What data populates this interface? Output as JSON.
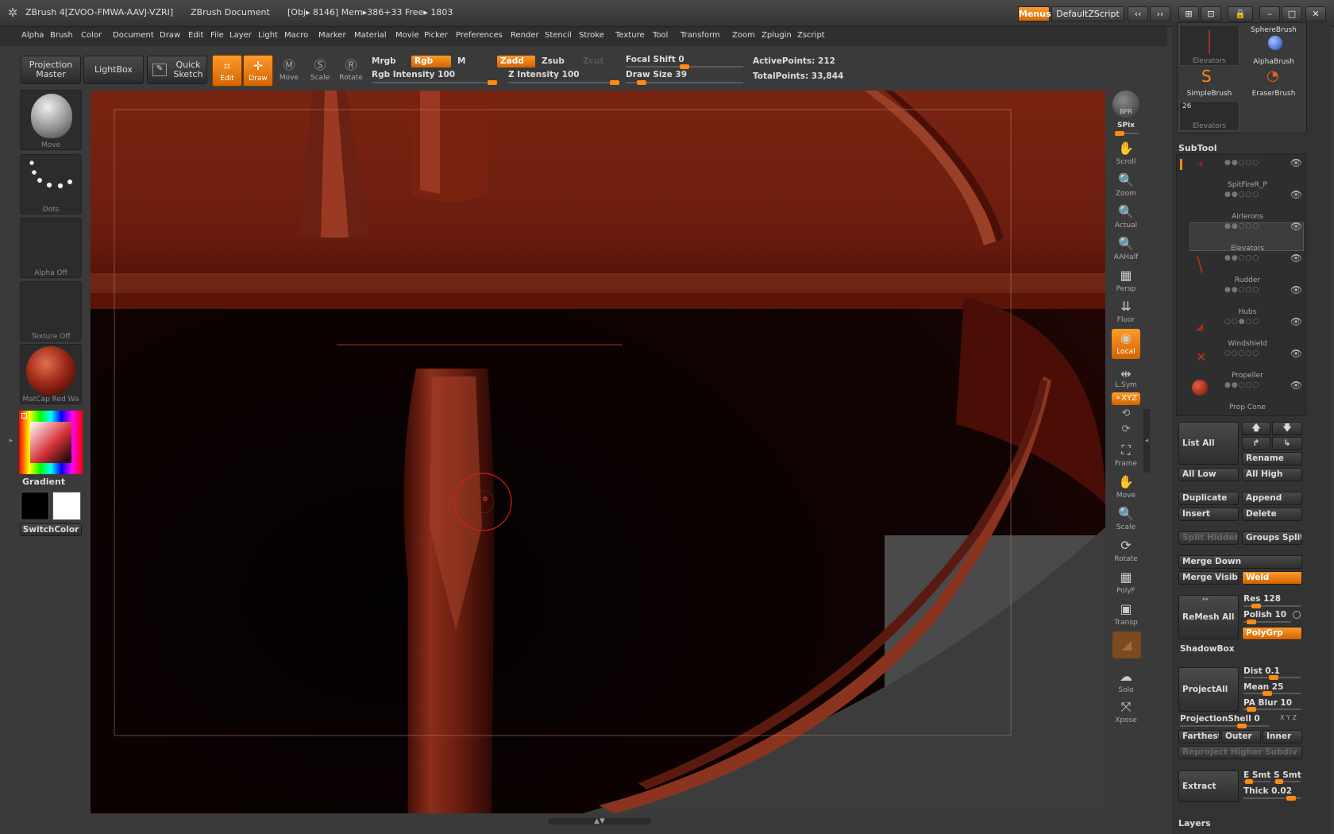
{
  "titlebar": {
    "app_title": "ZBrush 4[ZVOO-FMWA-AAVJ-VZRI]",
    "document": "ZBrush Document",
    "stats": "[Obj▸ 8146] Mem▸386+33 Free▸ 1803",
    "menus_btn": "Menus",
    "script_btn": "DefaultZScript"
  },
  "menubar": [
    "Alpha",
    "Brush",
    "Color",
    "Document",
    "Draw",
    "Edit",
    "File",
    "Layer",
    "Light",
    "Macro",
    "Marker",
    "Material",
    "Movie",
    "Picker",
    "Preferences",
    "Render",
    "Stencil",
    "Stroke",
    "Texture",
    "Tool",
    "Transform",
    "Zoom",
    "Zplugin",
    "Zscript"
  ],
  "shelf": {
    "projection_master": "Projection Master",
    "lightbox": "LightBox",
    "quick_sketch": "Quick Sketch",
    "edit": "Edit",
    "draw": "Draw",
    "move": "Move",
    "scale": "Scale",
    "rotate": "Rotate",
    "mrgb": "Mrgb",
    "rgb": "Rgb",
    "m": "M",
    "rgb_intensity": "Rgb  Intensity 100",
    "zadd": "Zadd",
    "zsub": "Zsub",
    "zcut": "Zcut",
    "z_intensity": "Z  Intensity 100",
    "focal_shift": "Focal  Shift 0",
    "draw_size": "Draw  Size 39",
    "active_points": "ActivePoints: 212",
    "total_points": "TotalPoints: 33,844",
    "rgb_intensity_value": 100,
    "z_intensity_value": 100,
    "focal_shift_value": 0,
    "draw_size_value": 39
  },
  "lefttray": {
    "brush": "Move",
    "stroke": "Dots",
    "alpha": "Alpha  Off",
    "texture": "Texture  Off",
    "material": "MatCap  Red  Wa",
    "gradient": "Gradient",
    "switch_color": "SwitchColor"
  },
  "righttool": [
    "BPR",
    "SPix",
    "Scroll",
    "Zoom",
    "Actual",
    "AAHalf",
    "Persp",
    "Floor",
    "Local",
    "L.Sym",
    "⚬XYZ",
    "Frame",
    "Move",
    "Scale",
    "Rotate",
    "PolyF",
    "Transp",
    "Solo",
    "Xpose"
  ],
  "panel": {
    "thumbs": [
      "SphereBrush",
      "AlphaBrush",
      "SimpleBrush",
      "EraserBrush",
      "Elevators",
      "Elevators"
    ],
    "thumb_count": "26",
    "subtool_title": "SubTool",
    "subtools": [
      "SpitFireR_P",
      "Airlerons",
      "Elevators",
      "Rudder",
      "Hubs",
      "Windshield",
      "Propeller",
      "Prop  Cone"
    ],
    "list_all": "List  All",
    "rename": "Rename",
    "all_low": "All  Low",
    "all_high": "All  High",
    "duplicate": "Duplicate",
    "append": "Append",
    "insert": "Insert",
    "delete": "Delete",
    "split_hidden": "Split  Hidden",
    "groups_split": "Groups  Split",
    "merge_down": "Merge  Down",
    "merge_visible": "Merge  Visible",
    "weld": "Weld",
    "remesh_all": "ReMesh  All",
    "res": "Res 128",
    "polish": "Polish 10",
    "polygrp": "PolyGrp",
    "shadowbox": "ShadowBox",
    "project_all": "ProjectAll",
    "dist": "Dist 0.1",
    "mean": "Mean 25",
    "pa_blur": "PA  Blur 10",
    "projection_shell": "ProjectionShell 0",
    "farthest": "Farthest",
    "outer": "Outer",
    "inner": "Inner",
    "reproject": "Reproject  Higher  Subdiv",
    "extract": "Extract",
    "e_smt": "E  Smt",
    "s_smt": "S  Smt",
    "thick": "Thick 0.02",
    "layers": "Layers"
  },
  "colors": {
    "accent": "#ff8a10",
    "model": "#6a1a10",
    "background": "#0c0202"
  }
}
